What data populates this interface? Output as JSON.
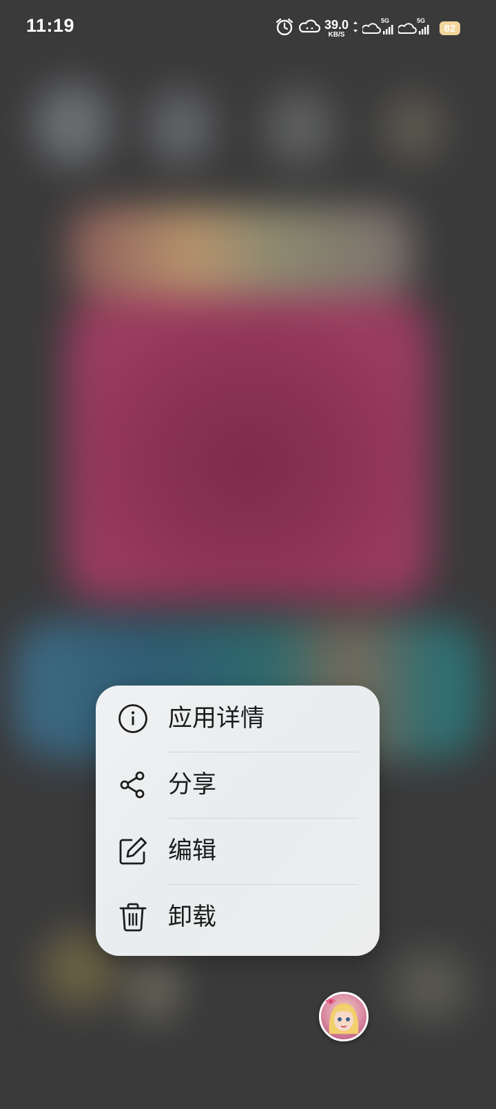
{
  "status_bar": {
    "time": "11:19",
    "net_speed_value": "39.0",
    "net_speed_unit": "KB/S",
    "signal_1_label": "5G",
    "signal_2_label": "5G",
    "battery_level": "82",
    "icons": [
      "alarm-icon",
      "weather-cloud-icon",
      "data-arrows-icon",
      "signal-5g-icon",
      "signal-5g-icon",
      "battery-icon"
    ]
  },
  "context_menu": {
    "items": [
      {
        "label": "应用详情",
        "icon": "info-icon"
      },
      {
        "label": "分享",
        "icon": "share-icon"
      },
      {
        "label": "编辑",
        "icon": "edit-icon"
      },
      {
        "label": "卸载",
        "icon": "trash-icon"
      }
    ]
  },
  "floating_avatar": {
    "icon": "cartoon-girl-avatar"
  }
}
